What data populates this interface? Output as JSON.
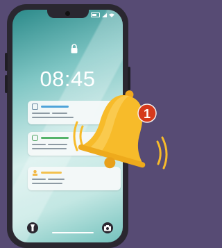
{
  "lock_screen": {
    "time": "08:45"
  },
  "notification_badge": {
    "count": "1"
  },
  "colors": {
    "bell": "#f7bb2a",
    "badge": "#d5391b",
    "background": "#574b74"
  },
  "icons": [
    "lock-icon",
    "flashlight-icon",
    "camera-icon",
    "bell-icon",
    "wifi-icon",
    "battery-icon",
    "signal-icon"
  ]
}
